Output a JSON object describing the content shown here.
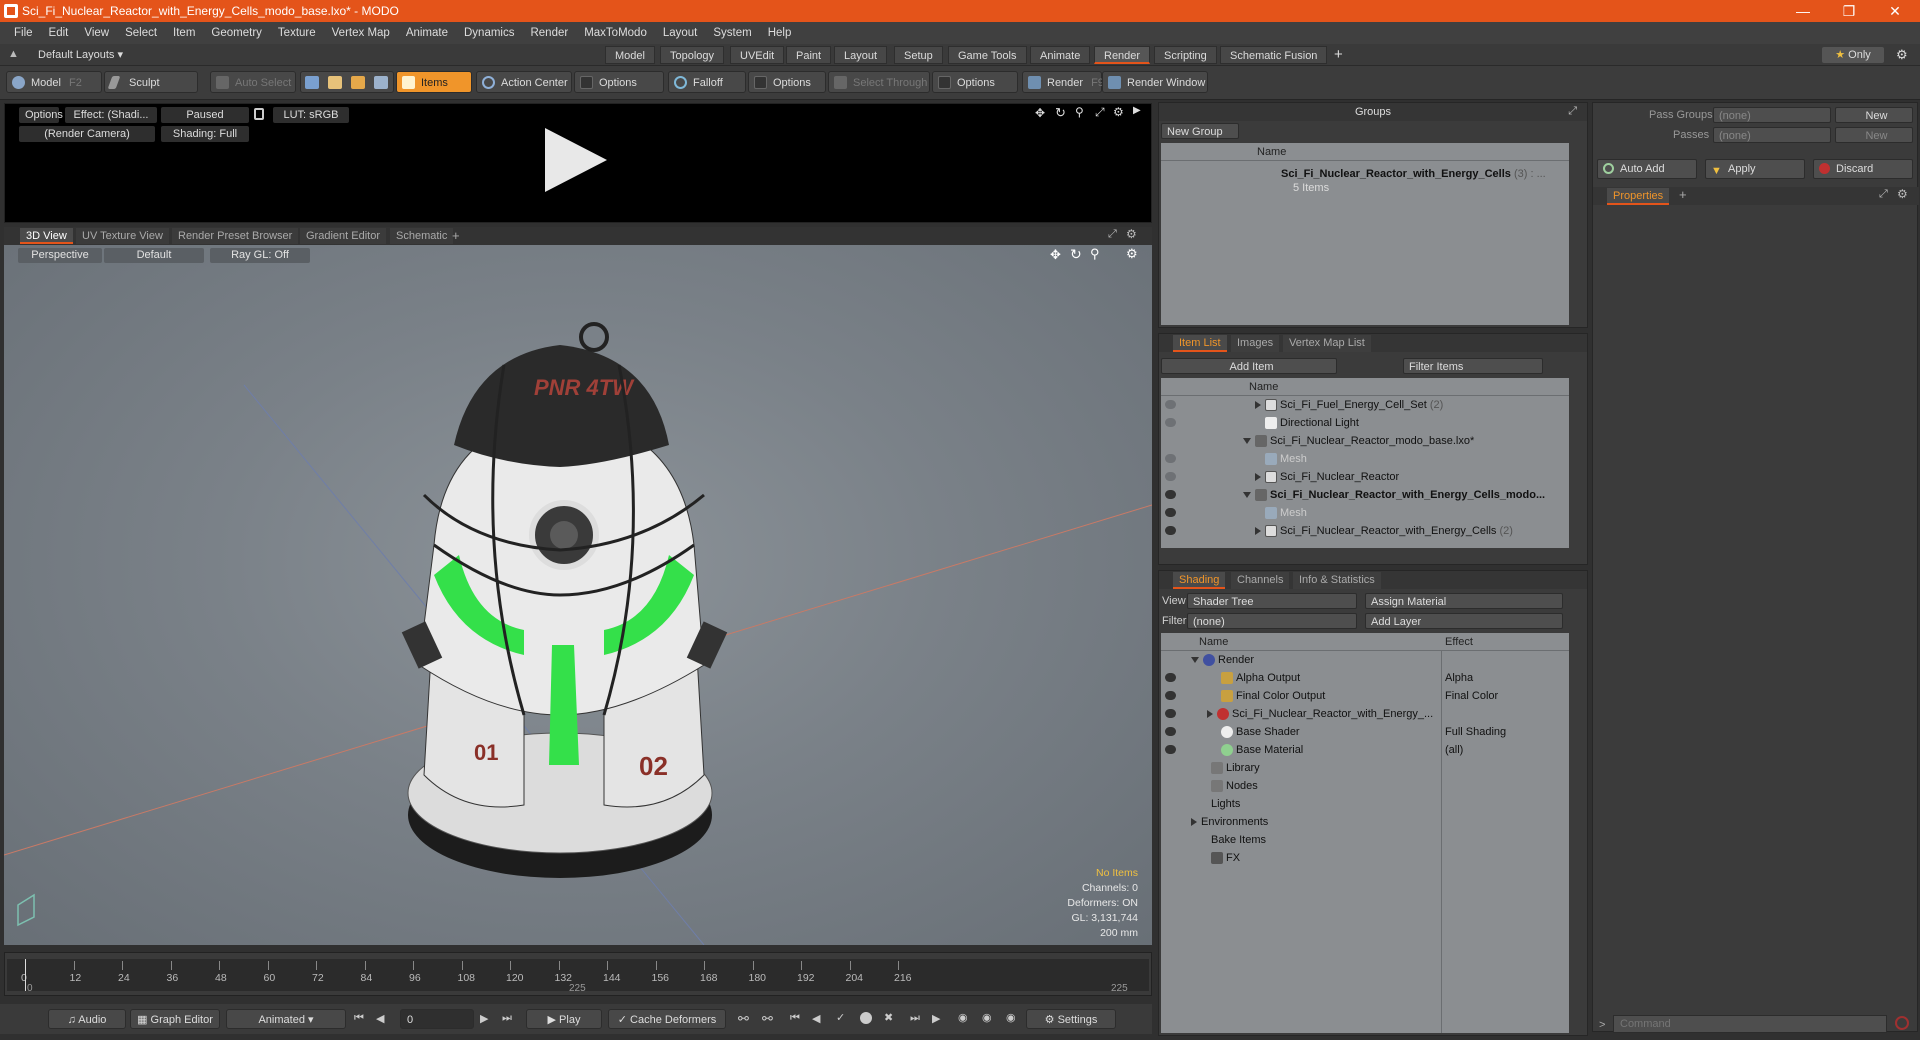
{
  "window": {
    "title": "Sci_Fi_Nuclear_Reactor_with_Energy_Cells_modo_base.lxo* - MODO"
  },
  "menu": [
    "File",
    "Edit",
    "View",
    "Select",
    "Item",
    "Geometry",
    "Texture",
    "Vertex Map",
    "Animate",
    "Dynamics",
    "Render",
    "MaxToModo",
    "Layout",
    "System",
    "Help"
  ],
  "layout_selector": "Default Layouts",
  "layout_tabs": [
    "Model",
    "Topology",
    "UVEdit",
    "Paint",
    "Layout",
    "Setup",
    "Game Tools",
    "Animate",
    "Render",
    "Scripting",
    "Schematic Fusion"
  ],
  "layout_active": "Render",
  "only_label": "Only",
  "toolbar": {
    "model": "Model",
    "model_key": "F2",
    "sculpt": "Sculpt",
    "auto_select": "Auto Select",
    "items": "Items",
    "action_center": "Action Center",
    "options1": "Options",
    "falloff": "Falloff",
    "options2": "Options",
    "select_through": "Select Through",
    "options3": "Options",
    "render": "Render",
    "render_key": "F9",
    "render_window": "Render Window"
  },
  "preview": {
    "options": "Options",
    "effect": "Effect: (Shadi...",
    "paused": "Paused",
    "lut": "LUT: sRGB",
    "camera": "(Render Camera)",
    "shading": "Shading: Full"
  },
  "viewport_tabs": [
    "3D View",
    "UV Texture View",
    "Render Preset Browser",
    "Gradient Editor",
    "Schematic"
  ],
  "viewport": {
    "perspective": "Perspective",
    "default": "Default",
    "raygl": "Ray GL: Off",
    "logo_text": "PNR 4TW",
    "num1": "01",
    "num2": "02"
  },
  "stats": {
    "no_items": "No Items",
    "channels": "Channels: 0",
    "deformers": "Deformers: ON",
    "gl": "GL: 3,131,744",
    "scale": "200 mm"
  },
  "timeline": {
    "ticks": [
      "0",
      "12",
      "24",
      "36",
      "48",
      "60",
      "72",
      "84",
      "96",
      "108",
      "120",
      "132",
      "144",
      "156",
      "168",
      "180",
      "192",
      "204",
      "216"
    ],
    "start": "0",
    "mid": "225",
    "end": "225"
  },
  "bottombar": {
    "audio": "Audio",
    "graph_editor": "Graph Editor",
    "animated": "Animated",
    "frame": "0",
    "play": "Play",
    "cache_deformers": "Cache Deformers",
    "settings": "Settings"
  },
  "groups": {
    "title": "Groups",
    "new_group": "New Group",
    "col_name": "Name",
    "item_name": "Sci_Fi_Nuclear_Reactor_with_Energy_Cells",
    "item_count": "(3) : ...",
    "item_sub": "5 Items"
  },
  "item_list": {
    "tabs": [
      "Item List",
      "Images",
      "Vertex Map List"
    ],
    "add_item": "Add Item",
    "filter": "Filter Items",
    "col_name": "Name",
    "rows": [
      {
        "label": "Sci_Fi_Fuel_Energy_Cell_Set",
        "suffix": "(2)"
      },
      {
        "label": "Directional Light",
        "suffix": ""
      },
      {
        "label": "Sci_Fi_Nuclear_Reactor_modo_base.lxo*",
        "suffix": ""
      },
      {
        "label": "Mesh",
        "suffix": ""
      },
      {
        "label": "Sci_Fi_Nuclear_Reactor",
        "suffix": ""
      },
      {
        "label": "Sci_Fi_Nuclear_Reactor_with_Energy_Cells_modo...",
        "suffix": ""
      },
      {
        "label": "Mesh",
        "suffix": ""
      },
      {
        "label": "Sci_Fi_Nuclear_Reactor_with_Energy_Cells",
        "suffix": "(2)"
      }
    ]
  },
  "shading": {
    "tabs": [
      "Shading",
      "Channels",
      "Info & Statistics"
    ],
    "view_label": "View",
    "view_value": "Shader Tree",
    "assign_material": "Assign Material",
    "filter_label": "Filter",
    "filter_value": "(none)",
    "add_layer": "Add Layer",
    "col_name": "Name",
    "col_effect": "Effect",
    "rows": [
      {
        "label": "Render",
        "effect": ""
      },
      {
        "label": "Alpha Output",
        "effect": "Alpha"
      },
      {
        "label": "Final Color Output",
        "effect": "Final Color"
      },
      {
        "label": "Sci_Fi_Nuclear_Reactor_with_Energy_...",
        "effect": ""
      },
      {
        "label": "Base Shader",
        "effect": "Full Shading"
      },
      {
        "label": "Base Material",
        "effect": "(all)"
      },
      {
        "label": "Library",
        "effect": ""
      },
      {
        "label": "Nodes",
        "effect": ""
      },
      {
        "label": "Lights",
        "effect": ""
      },
      {
        "label": "Environments",
        "effect": ""
      },
      {
        "label": "Bake Items",
        "effect": ""
      },
      {
        "label": "FX",
        "effect": ""
      }
    ]
  },
  "pass": {
    "pass_groups": "Pass Groups",
    "passes": "Passes",
    "none": "(none)",
    "new": "New",
    "auto_add": "Auto Add",
    "apply": "Apply",
    "discard": "Discard",
    "properties": "Properties"
  },
  "command": {
    "placeholder": "Command"
  },
  "colors": {
    "accent": "#e4541a",
    "orange": "#f0952a",
    "green_glow": "#34e04a"
  }
}
